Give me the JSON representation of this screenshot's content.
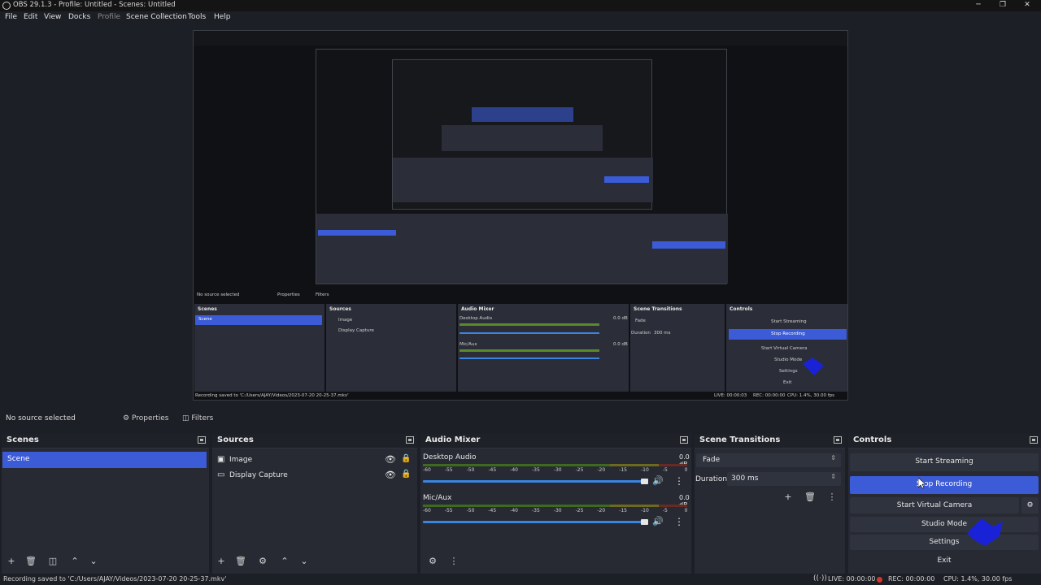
{
  "window": {
    "title": "OBS 29.1.3 - Profile: Untitled - Scenes: Untitled"
  },
  "menu": [
    "File",
    "Edit",
    "View",
    "Docks",
    "Profile",
    "Scene Collection",
    "Tools",
    "Help"
  ],
  "preview_nested": {
    "no_source": "No source selected",
    "properties": "Properties",
    "filters": "Filters",
    "scenes": "Scenes",
    "scene": "Scene",
    "sources": "Sources",
    "image": "Image",
    "display_capture": "Display Capture",
    "audio_mixer": "Audio Mixer",
    "desktop_audio": "Desktop Audio",
    "mic_aux": "Mic/Aux",
    "db": "0.0 dB",
    "scene_transitions": "Scene Transitions",
    "fade": "Fade",
    "duration": "Duration",
    "ms": "300 ms",
    "controls": "Controls",
    "start_streaming": "Start Streaming",
    "stop_recording": "Stop Recording",
    "start_virtual_camera": "Start Virtual Camera",
    "studio_mode": "Studio Mode",
    "settings": "Settings",
    "exit": "Exit",
    "recording_saved": "Recording saved to 'C:/Users/AJAY/Videos/2023-07-20 20-25-37.mkv'",
    "live": "LIVE: 00:00:03",
    "rec": "REC: 00:00:00",
    "cpu": "CPU: 1.4%, 30.00 fps"
  },
  "status_row": {
    "no_source": "No source selected",
    "properties": "Properties",
    "filters": "Filters"
  },
  "scenes": {
    "title": "Scenes",
    "items": [
      "Scene"
    ]
  },
  "sources": {
    "title": "Sources",
    "items": [
      "Image",
      "Display Capture"
    ]
  },
  "audio_mixer": {
    "title": "Audio Mixer",
    "channels": [
      {
        "name": "Desktop Audio",
        "db": "0.0 dB"
      },
      {
        "name": "Mic/Aux",
        "db": "0.0 dB"
      }
    ],
    "ticks": [
      "-60",
      "-55",
      "-50",
      "-45",
      "-40",
      "-35",
      "-30",
      "-25",
      "-20",
      "-15",
      "-10",
      "-5",
      "0"
    ]
  },
  "scene_transitions": {
    "title": "Scene Transitions",
    "transition": "Fade",
    "duration_label": "Duration",
    "duration_value": "300 ms"
  },
  "controls": {
    "title": "Controls",
    "start_streaming": "Start Streaming",
    "stop_recording": "Stop Recording",
    "start_virtual_camera": "Start Virtual Camera",
    "studio_mode": "Studio Mode",
    "settings": "Settings",
    "exit": "Exit"
  },
  "statusbar": {
    "recording_saved": "Recording saved to 'C:/Users/AJAY/Videos/2023-07-20 20-25-37.mkv'",
    "live": "LIVE: 00:00:00",
    "rec": "REC: 00:00:00",
    "cpu": "CPU: 1.4%, 30.00 fps"
  },
  "colors": {
    "accent": "#3b5bd7",
    "panel": "#272a33",
    "background": "#1d1f26",
    "rec_dot": "#d9342b"
  }
}
